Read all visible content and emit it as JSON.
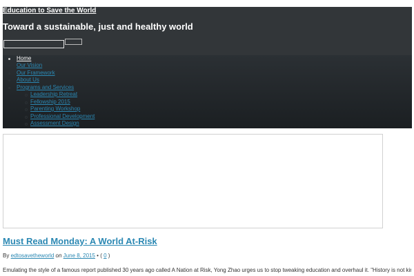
{
  "site": {
    "title": "Education to Save the World",
    "tagline": "Toward a sustainable, just and healthy world"
  },
  "search": {
    "input_value": "",
    "button_label": ""
  },
  "nav": {
    "items": [
      {
        "label": "Home",
        "current": true
      },
      {
        "label": "Our Vision"
      },
      {
        "label": "Our Framework"
      },
      {
        "label": "About Us"
      },
      {
        "label": "Programs and Services"
      }
    ],
    "subitems": [
      {
        "label": "Leadership Retreat"
      },
      {
        "label": "Fellowship 2015"
      },
      {
        "label": "Parenting Workshop"
      },
      {
        "label": "Professional Development"
      },
      {
        "label": "Assessment Design"
      }
    ]
  },
  "post": {
    "title": "Must Read Monday: A World At-Risk",
    "by_label": "By",
    "author": "edtosavetheworld",
    "on_label": "on",
    "date": "June 8, 2015",
    "comments_prefix": "• (",
    "comments_count": "0",
    "comments_suffix": ")",
    "excerpt": "Emulating the style of a famous report published 30 years ago called A Nation at Risk, Yong Zhao urges us to stop tweaking education and overhaul it. \"History is not kind to the A Nation at Risk... Excellence in Education, 1983 … Read More",
    "read_more": ""
  },
  "colors": {
    "header_bg": "#323639",
    "nav_bg_top": "#2b3034",
    "nav_bg_bottom": "#1b1f22",
    "link": "#2b88b3",
    "text": "#333333"
  }
}
